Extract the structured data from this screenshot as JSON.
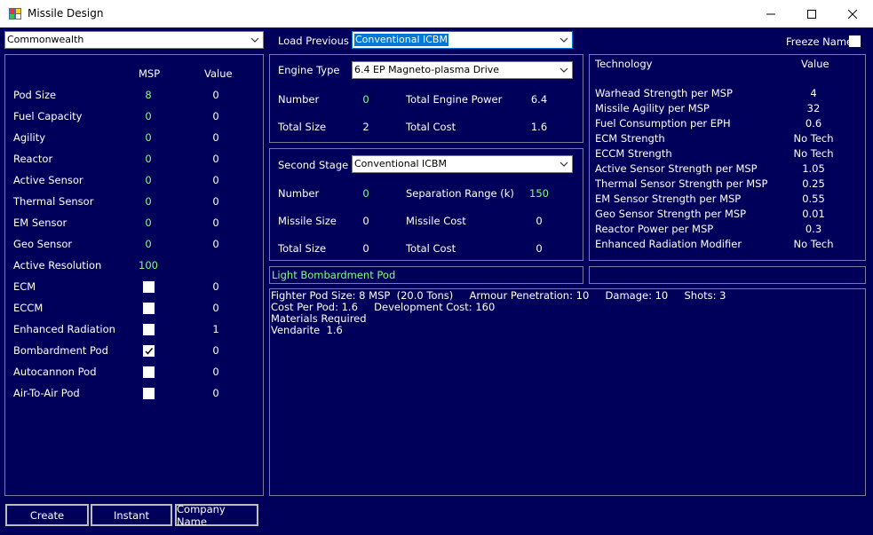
{
  "window": {
    "title": "Missile Design"
  },
  "empire_select": {
    "value": "Commonwealth"
  },
  "load_previous": {
    "label": "Load Previous",
    "value": "Conventional ICBM"
  },
  "freeze_name": {
    "label": "Freeze Name",
    "checked": false
  },
  "components": {
    "col_msp": "MSP",
    "col_value": "Value",
    "rows": [
      {
        "label": "Pod Size",
        "msp": "8",
        "value": "0"
      },
      {
        "label": "Fuel Capacity",
        "msp": "0",
        "value": "0"
      },
      {
        "label": "Agility",
        "msp": "0",
        "value": "0"
      },
      {
        "label": "Reactor",
        "msp": "0",
        "value": "0"
      },
      {
        "label": "Active Sensor",
        "msp": "0",
        "value": "0"
      },
      {
        "label": "Thermal Sensor",
        "msp": "0",
        "value": "0"
      },
      {
        "label": "EM Sensor",
        "msp": "0",
        "value": "0"
      },
      {
        "label": "Geo Sensor",
        "msp": "0",
        "value": "0"
      },
      {
        "label": "Active Resolution",
        "msp": "100",
        "value": ""
      },
      {
        "label": "ECM",
        "checked": false,
        "value": "0"
      },
      {
        "label": "ECCM",
        "checked": false,
        "value": "0"
      },
      {
        "label": "Enhanced Radiation",
        "checked": false,
        "value": "1"
      },
      {
        "label": "Bombardment Pod",
        "checked": true,
        "value": "0"
      },
      {
        "label": "Autocannon Pod",
        "checked": false,
        "value": "0"
      },
      {
        "label": "Air-To-Air Pod",
        "checked": false,
        "value": "0"
      }
    ]
  },
  "engine": {
    "type_label": "Engine Type",
    "type_value": "6.4 EP Magneto-plasma Drive",
    "number_label": "Number",
    "number": "0",
    "total_power_label": "Total Engine Power",
    "total_power": "6.4",
    "total_size_label": "Total Size",
    "total_size": "2",
    "total_cost_label": "Total Cost",
    "total_cost": "1.6"
  },
  "second_stage": {
    "label": "Second Stage",
    "value": "Conventional ICBM",
    "number_label": "Number",
    "number": "0",
    "sep_range_label": "Separation Range (k)",
    "sep_range": "150",
    "missile_size_label": "Missile Size",
    "missile_size": "0",
    "missile_cost_label": "Missile Cost",
    "missile_cost": "0",
    "total_size_label": "Total Size",
    "total_size": "0",
    "total_cost_label": "Total Cost",
    "total_cost": "0"
  },
  "technology": {
    "col_tech": "Technology",
    "col_value": "Value",
    "rows": [
      {
        "label": "Warhead Strength per MSP",
        "value": "4"
      },
      {
        "label": "Missile Agility per MSP",
        "value": "32"
      },
      {
        "label": "Fuel Consumption per EPH",
        "value": "0.6"
      },
      {
        "label": "ECM Strength",
        "value": "No Tech"
      },
      {
        "label": "ECCM Strength",
        "value": "No Tech"
      },
      {
        "label": "Active Sensor Strength per MSP",
        "value": "1.05"
      },
      {
        "label": "Thermal Sensor Strength per MSP",
        "value": "0.25"
      },
      {
        "label": "EM Sensor Strength per MSP",
        "value": "0.55"
      },
      {
        "label": "Geo Sensor Strength per MSP",
        "value": "0.01"
      },
      {
        "label": "Reactor Power per MSP",
        "value": "0.3"
      },
      {
        "label": "Enhanced Radiation Modifier",
        "value": "No Tech"
      }
    ]
  },
  "design_name": "Light Bombardment Pod",
  "summary": {
    "lines": [
      "Fighter Pod Size: 8 MSP  (20.0 Tons)     Armour Penetration: 10     Damage: 10     Shots: 3",
      "Cost Per Pod: 1.6     Development Cost: 160",
      "Materials Required",
      "Vendarite  1.6"
    ]
  },
  "buttons": {
    "create": "Create",
    "instant": "Instant",
    "company_name": "Company Name"
  },
  "colors": {
    "background": "#00005a",
    "highlight_value": "#80ff80",
    "selection": "#0078d7"
  }
}
